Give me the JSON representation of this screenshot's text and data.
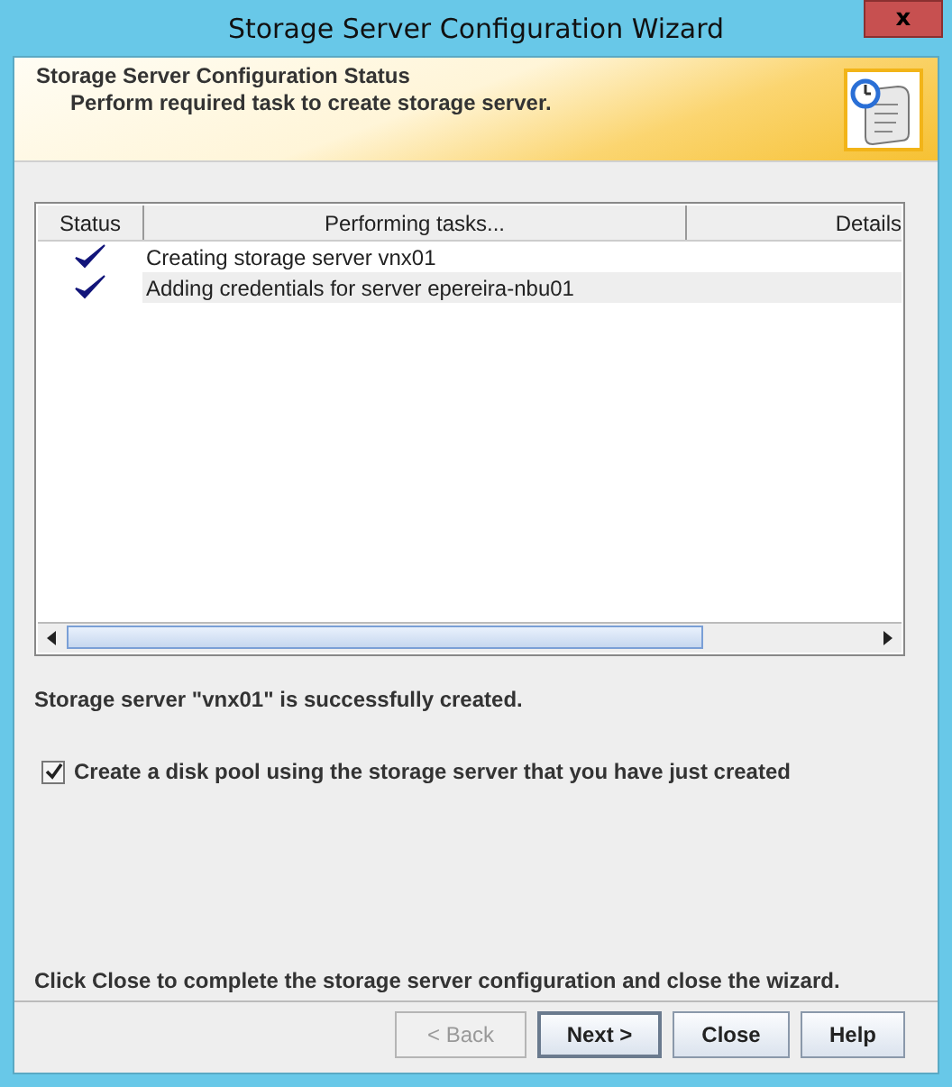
{
  "window": {
    "title": "Storage Server Configuration Wizard",
    "close": "x"
  },
  "header": {
    "title": "Storage Server Configuration Status",
    "subtitle": "Perform required task to create storage server."
  },
  "table": {
    "columns": [
      "Status",
      "Performing tasks...",
      "Details"
    ],
    "rows": [
      {
        "done": true,
        "task": "Creating storage server vnx01",
        "striped": false
      },
      {
        "done": true,
        "task": "Adding credentials for server epereira-nbu01",
        "striped": true
      }
    ]
  },
  "message": "Storage server \"vnx01\" is successfully created.",
  "checkbox": {
    "label": "Create a disk pool using the storage server that you have just created",
    "checked": true
  },
  "footer_text": "Click Close to complete the storage server configuration and close the wizard.",
  "buttons": [
    {
      "label": "< Back",
      "disabled": true,
      "default": false
    },
    {
      "label": "Next >",
      "disabled": false,
      "default": true
    },
    {
      "label": "Close",
      "disabled": false,
      "default": false
    },
    {
      "label": "Help",
      "disabled": false,
      "default": false
    }
  ]
}
